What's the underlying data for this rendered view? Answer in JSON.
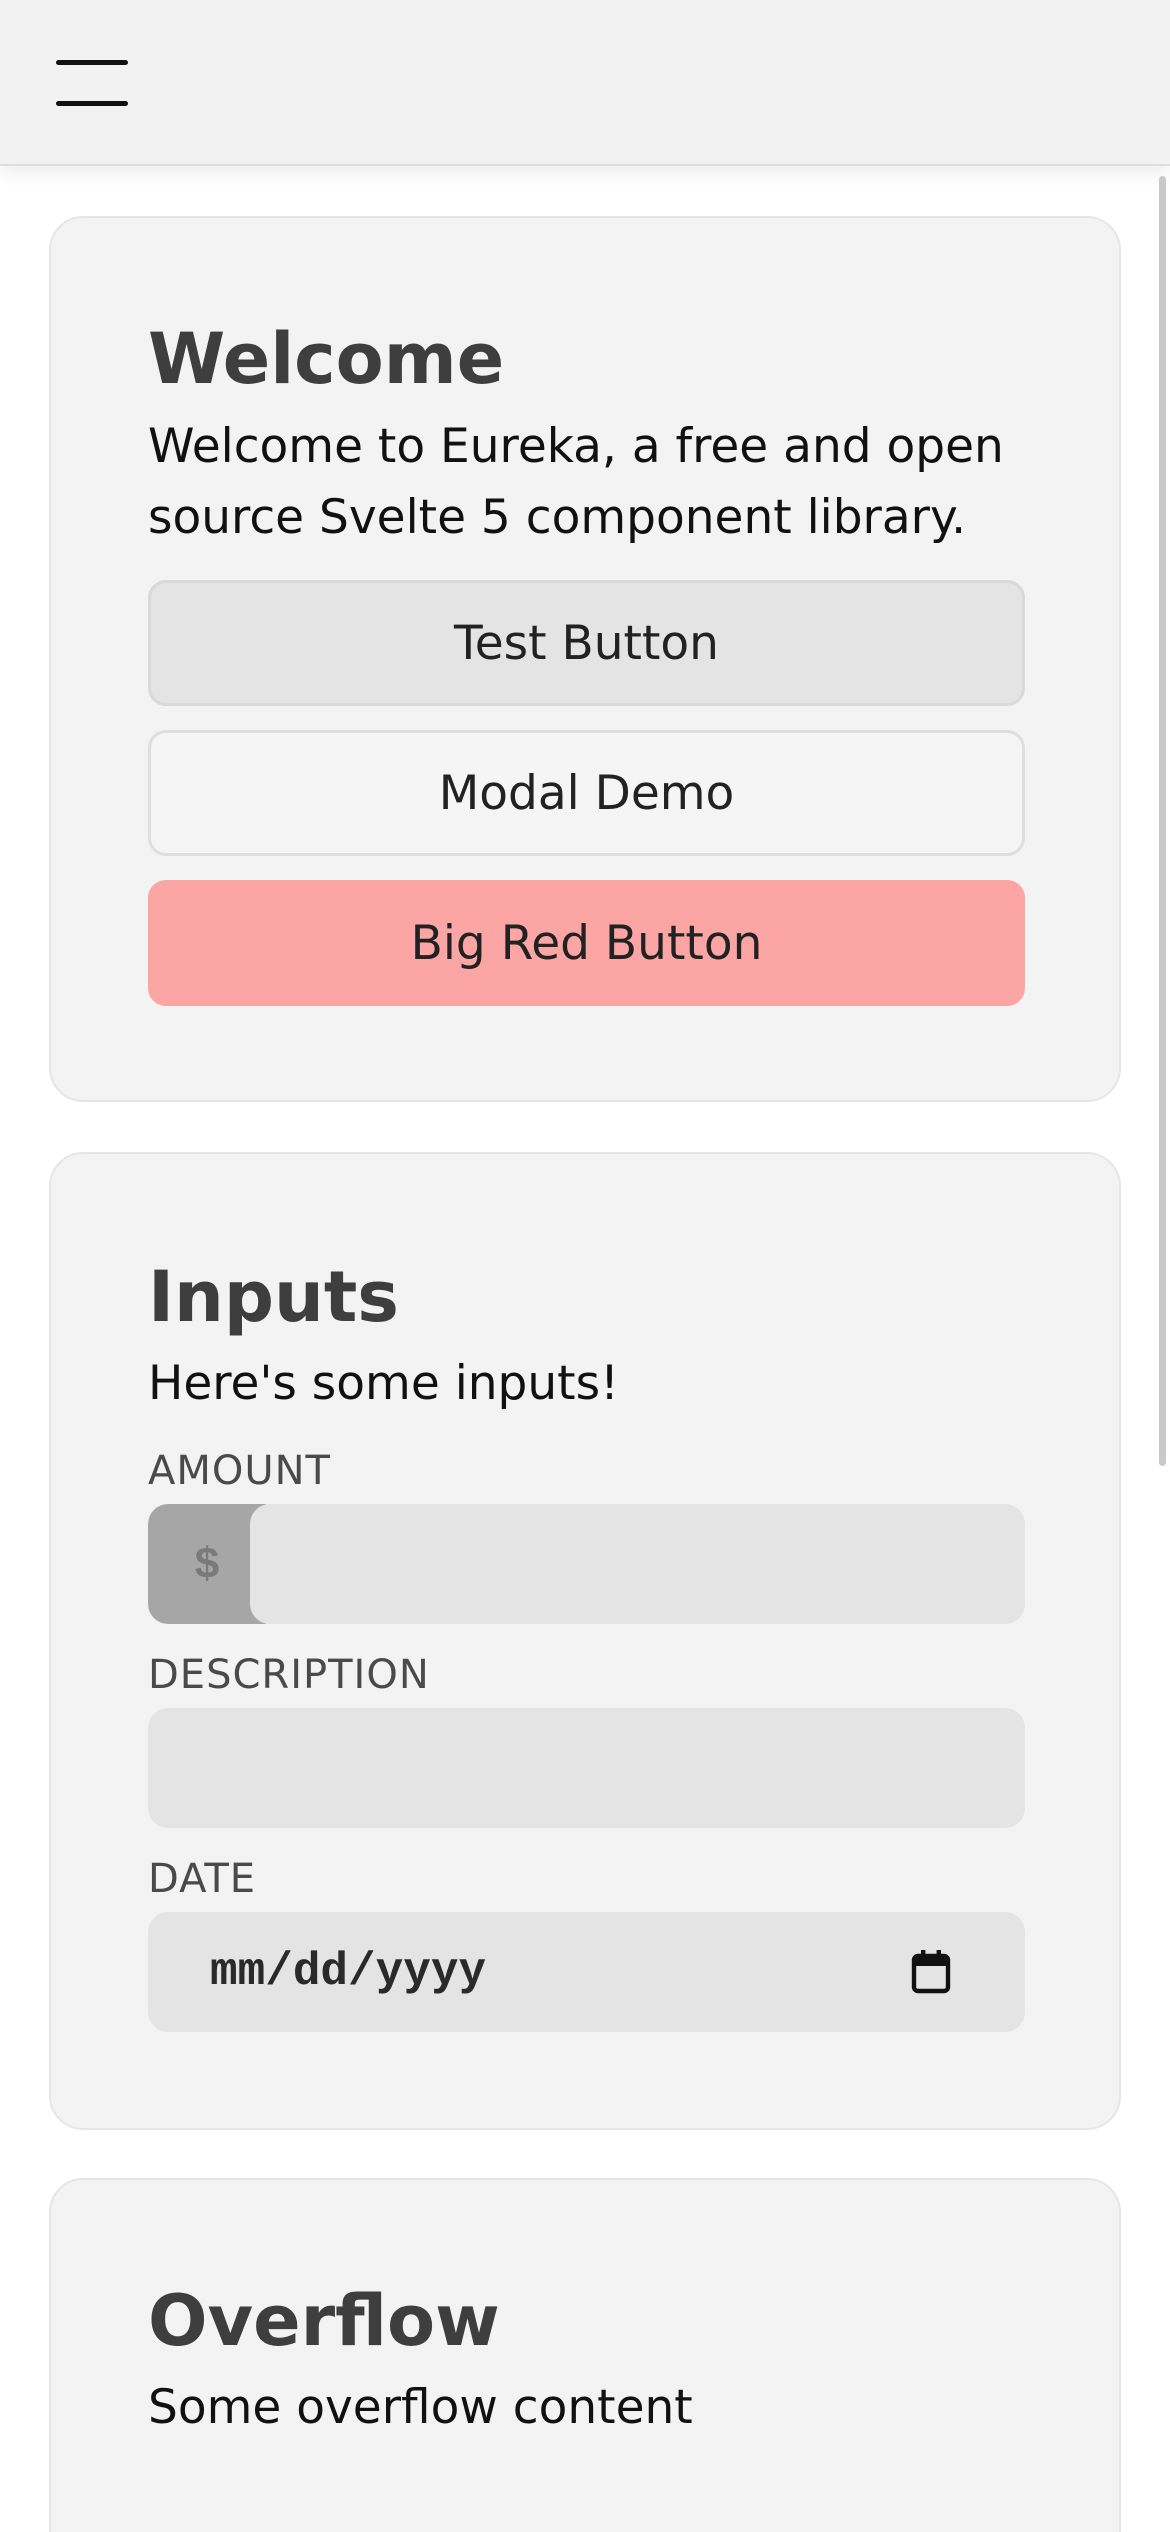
{
  "header": {
    "menu_icon": "hamburger-menu-icon"
  },
  "welcome": {
    "title": "Welcome",
    "description": "Welcome to Eureka, a free and open source Svelte 5 component library.",
    "buttons": [
      {
        "label": "Test Button"
      },
      {
        "label": "Modal Demo"
      },
      {
        "label": "Big Red Button",
        "color": "#fca5a5"
      }
    ]
  },
  "inputs": {
    "title": "Inputs",
    "description": "Here's some inputs!",
    "amount": {
      "label": "AMOUNT",
      "prefix": "$",
      "value": ""
    },
    "description_field": {
      "label": "DESCRIPTION",
      "value": ""
    },
    "date": {
      "label": "DATE",
      "placeholder": "mm/dd/yyyy",
      "icon": "calendar-icon"
    }
  },
  "overflow": {
    "title": "Overflow",
    "description": "Some overflow content"
  },
  "colors": {
    "card_bg": "#f3f3f3",
    "input_bg": "#e4e4e4",
    "danger": "#fca5a5",
    "title_text": "#3e3e3e"
  }
}
